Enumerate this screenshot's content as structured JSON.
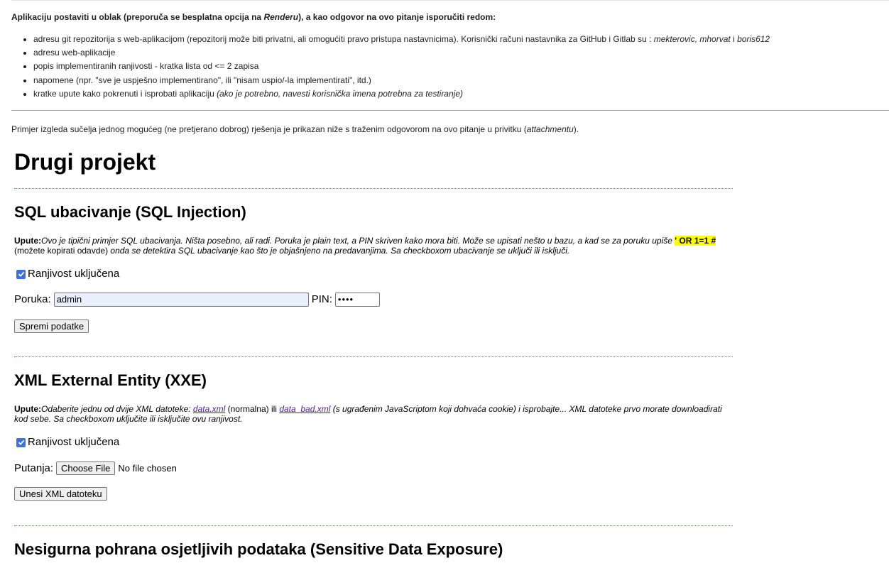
{
  "intro": {
    "heading_before": "Aplikaciju postaviti u oblak (preporuča se besplatna opcija na ",
    "heading_em": "Renderu",
    "heading_after": "), a kao odgovor na ovo pitanje isporučiti redom:",
    "items": {
      "repo_text": "adresu git repozitorija s web-aplikacijom (repozitorij može biti privatni, ali omogućiti pravo pristupa nastavnicima). Korisnički računi nastavnika za GitHub i Gitlab su : ",
      "repo_users": "mekterovic, mhorvat",
      "repo_and": " i ",
      "repo_user3": "boris612",
      "web_address": "adresu web-aplikacije",
      "vuln_list": "popis implementiranih ranjivosti - kratka lista od <= 2 zapisa",
      "notes": "napomene (npr. \"sve je uspješno implementirano\", ili \"nisam uspio/-la implementirati\", itd.)",
      "instructions_text": "kratke upute kako pokrenuti i isprobati aplikaciju ",
      "instructions_em": "(ako je potrebno, navesti korisnička imena potrebna za testiranje)"
    },
    "example_before": "Primjer izgleda sučelja jednog mogućeg (ne pretjerano dobrog) rješenja je prikazan niže s traženim odgovorom na ovo pitanje u privitku (",
    "example_em": "attachmentu",
    "example_after": ")."
  },
  "demo": {
    "title": "Drugi projekt",
    "sql": {
      "title": "SQL ubacivanje (SQL Injection)",
      "label": "Upute:",
      "text1": "Ovo je tipični primjer SQL ubacivanja. Ništa posebno, ali radi. Poruka je plain text, a PIN skriven kako mora biti. Može se upisati nešto u bazu, a kad se za poruku upiše ",
      "highlight": "' OR 1=1 #",
      "copy_note": " (možete kopirati odavde)",
      "text2": " onda se detektira SQL ubacivanje kao što je objašnjeno na predavanjima. Sa checkboxom ubacivanje se uključi ili isključi.",
      "checkbox_label": "Ranjivost uključena",
      "checkbox_checked": true,
      "message_label": "Poruka:",
      "message_value": "admin",
      "pin_label": "PIN:",
      "pin_value": "••••",
      "save_button": "Spremi podatke"
    },
    "xxe": {
      "title": "XML External Entity (XXE)",
      "label": "Upute:",
      "text1": "Odaberite jednu od dvije XML datoteke: ",
      "link1": "data.xml",
      "normal": " (normalna)",
      "or": " ili ",
      "link2": "data_bad.xml",
      "text2": " (s ugrađenim JavaScriptom koji dohvaća cookie) i isprobajte... XML datoteke prvo morate downloadirati kod sebe. Sa checkboxom uključite ili isključite ovu ranjivost.",
      "checkbox_label": "Ranjivost uključena",
      "checkbox_checked": true,
      "path_label": "Putanja:",
      "choose_file": "Choose File",
      "no_file": "No file chosen",
      "submit_button": "Unesi XML datoteku"
    },
    "sde": {
      "title": "Nesigurna pohrana osjetljivih podataka (Sensitive Data Exposure)"
    }
  },
  "colors": {
    "highlight": "#ffff00",
    "checkbox": "#3f6fd8",
    "separator": "#e05050",
    "autofill": "#e8f0fe",
    "link": "#551a8b"
  }
}
